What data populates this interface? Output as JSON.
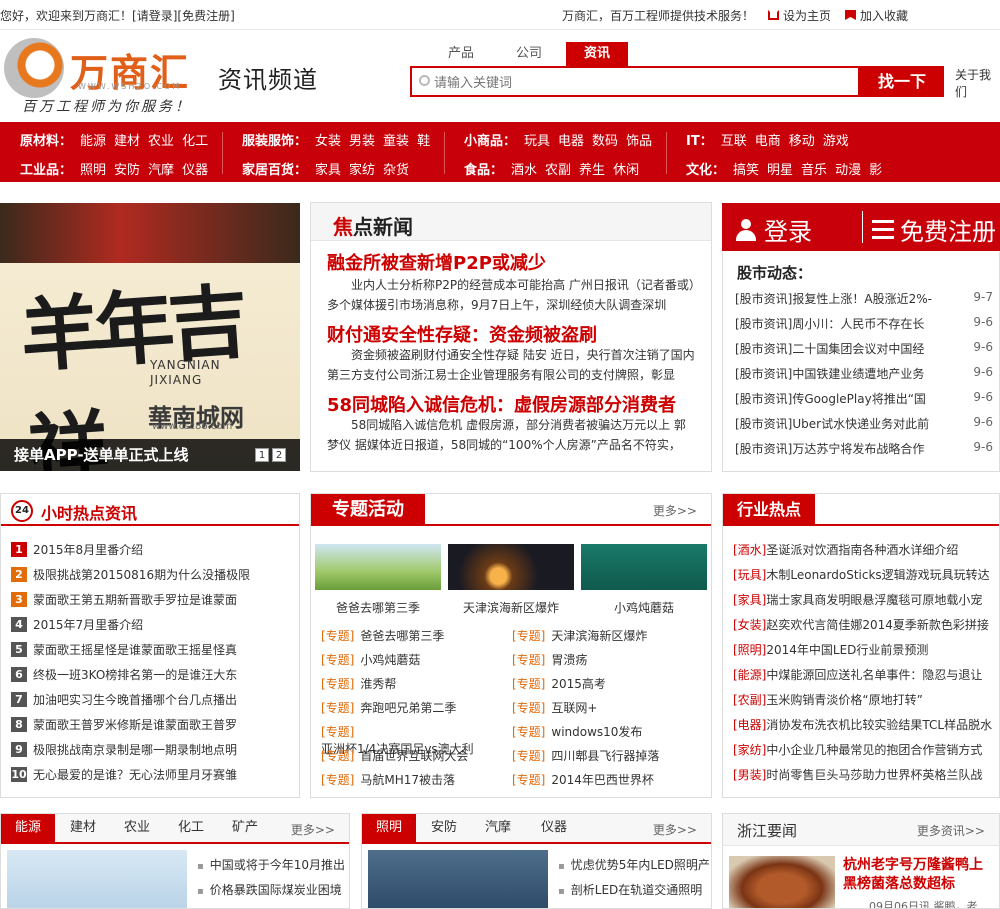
{
  "topbar": {
    "welcome": "您好，欢迎来到万商汇！",
    "login": "[请登录]",
    "register": "[免费注册]",
    "slogan": "万商汇，百万工程师提供技术服务！",
    "set_home": "设为主页",
    "add_fav": "加入收藏"
  },
  "header": {
    "logo_text": "万商汇",
    "logo_url": "WWW.WSHZO.COM",
    "slogan": "百万工程师为你服务！",
    "channel": "资讯频道",
    "search_tabs": [
      "产品",
      "公司",
      "资讯"
    ],
    "search_placeholder": "请输入关键词",
    "search_button": "找一下",
    "about": "关于我们"
  },
  "nav": {
    "row1": [
      {
        "cat": "原材料：",
        "items": [
          "能源",
          "建材",
          "农业",
          "化工"
        ]
      },
      {
        "cat": "服装服饰：",
        "items": [
          "女装",
          "男装",
          "童装",
          "鞋"
        ]
      },
      {
        "cat": "小商品：",
        "items": [
          "玩具",
          "电器",
          "数码",
          "饰品"
        ]
      },
      {
        "cat": "IT：",
        "items": [
          "互联",
          "电商",
          "移动",
          "游戏"
        ]
      }
    ],
    "row2": [
      {
        "cat": "工业品：",
        "items": [
          "照明",
          "安防",
          "汽摩",
          "仪器"
        ]
      },
      {
        "cat": "家居百货：",
        "items": [
          "家具",
          "家纺",
          "杂货"
        ]
      },
      {
        "cat": "食品：",
        "items": [
          "酒水",
          "农副",
          "养生",
          "休闲"
        ]
      },
      {
        "cat": "文化：",
        "items": [
          "搞笑",
          "明星",
          "音乐",
          "动漫",
          "影"
        ]
      }
    ]
  },
  "banner": {
    "caption": "接单APP-送单单正式上线",
    "pages": [
      "1",
      "2"
    ],
    "art_text": "羊年吉祥",
    "art_en": "YANGNIAN\nJIXIANG",
    "art_brand": "華南城网",
    "art_site": "www.csc86.com"
  },
  "focus": {
    "title_red": "焦",
    "title_rest": "点新闻",
    "items": [
      {
        "title": "融金所被查新增P2P或减少",
        "desc": "业内人士分析称P2P的经营成本可能抬高 广州日报讯（记者番或）多个媒体援引市场消息称，9月7日上午，深圳经侦大队调查深圳"
      },
      {
        "title": "财付通安全性存疑：资金频被盗刷",
        "desc": "资金频被盗刷财付通安全性存疑 陆安 近日，央行首次注销了国内第三方支付公司浙江易士企业管理服务有限公司的支付牌照，彰显"
      },
      {
        "title": "58同城陷入诚信危机：虚假房源部分消费者",
        "desc": "58同城陷入诚信危机 虚假房源，部分消费者被骗达万元以上 郭梦仪 据媒体近日报道，58同城的“100%个人房源”产品名不符实，"
      }
    ]
  },
  "login_box": {
    "login": "登录",
    "register": "免费注册"
  },
  "stock": {
    "title": "股市动态：",
    "items": [
      {
        "text": "[股市资讯]报复性上涨！A股涨近2%-",
        "date": "9-7"
      },
      {
        "text": "[股市资讯]周小川：人民币不存在长",
        "date": "9-6"
      },
      {
        "text": "[股市资讯]二十国集团会议对中国经",
        "date": "9-6"
      },
      {
        "text": "[股市资讯]中国铁建业绩遭地产业务",
        "date": "9-6"
      },
      {
        "text": "[股市资讯]传GooglePlay将推出“国",
        "date": "9-6"
      },
      {
        "text": "[股市资讯]Uber试水快递业务对此前",
        "date": "9-6"
      },
      {
        "text": "[股市资讯]万达苏宁将发布战略合作",
        "date": "9-6"
      }
    ]
  },
  "hot24": {
    "badge": "24",
    "title": "小时热点资讯",
    "items": [
      "2015年8月里番介绍",
      "极限挑战第20150816期为什么没播极限",
      "蒙面歌王第五期新晋歌手罗拉是谁蒙面",
      "2015年7月里番介绍",
      "蒙面歌王摇星怪是谁蒙面歌王摇星怪真",
      "终极一班3KO榜排名第一的是谁汪大东",
      "加油吧实习生今晚首播哪个台几点播出",
      "蒙面歌王普罗米修斯是谁蒙面歌王普罗",
      "极限挑战南京录制是哪一期录制地点明",
      "无心最爱的是谁？无心法师里月牙赛雏"
    ]
  },
  "topic": {
    "title": "专题活动",
    "more": "更多>>",
    "thumbs": [
      "爸爸去哪第三季",
      "天津滨海新区爆炸",
      "小鸡炖蘑菇"
    ],
    "tag": "[专题]",
    "left": [
      "爸爸去哪第三季",
      "小鸡炖蘑菇",
      "淮秀帮",
      "奔跑吧兄弟第二季",
      "亚洲杯1/4决赛国足vs澳大利",
      "首届世界互联网大会",
      "马航MH17被击落"
    ],
    "right": [
      "天津滨海新区爆炸",
      "胃溃疡",
      "2015高考",
      "互联网+",
      "windows10发布",
      "四川郫县飞行器掉落",
      "2014年巴西世界杯"
    ]
  },
  "industry": {
    "title": "行业热点",
    "items": [
      {
        "tag": "[酒水]",
        "text": "圣诞派对饮酒指南各种酒水详细介绍"
      },
      {
        "tag": "[玩具]",
        "text": "木制LeonardoSticks逻辑游戏玩具玩转达"
      },
      {
        "tag": "[家具]",
        "text": "瑞士家具商发明眼悬浮魔毯可原地载小宠"
      },
      {
        "tag": "[女装]",
        "text": "赵奕欢代言简佳娜2014夏季新款色彩拼接"
      },
      {
        "tag": "[照明]",
        "text": "2014年中国LED行业前景预测"
      },
      {
        "tag": "[能源]",
        "text": "中煤能源回应送礼名单事件：隐忍与退让"
      },
      {
        "tag": "[农副]",
        "text": "玉米购销青淡价格“原地打转”"
      },
      {
        "tag": "[电器]",
        "text": "消协发布洗衣机比较实验结果TCL样品脱水"
      },
      {
        "tag": "[家纺]",
        "text": "中小企业几种最常见的抱团合作营销方式"
      },
      {
        "tag": "[男装]",
        "text": "时尚零售巨头马莎助力世界杯英格兰队战"
      }
    ]
  },
  "bottom": {
    "sec1": {
      "tabs": [
        "能源",
        "建材",
        "农业",
        "化工",
        "矿产"
      ],
      "more": "更多>>",
      "items": [
        "中国或将于今年10月推出",
        "价格暴跌国际煤炭业困境"
      ]
    },
    "sec2": {
      "tabs": [
        "照明",
        "安防",
        "汽摩",
        "仪器"
      ],
      "more": "更多>>",
      "items": [
        "忧虑优势5年内LED照明产",
        "剖析LED在轨道交通照明"
      ]
    },
    "sec3": {
      "title": "浙江要闻",
      "more": "更多资讯>>",
      "headline": "杭州老字号万隆酱鸭上黑榜菌落总数超标",
      "meta": "09月06日讯  酱鸭，老"
    }
  },
  "colors": {
    "brand_red": "#c8000a",
    "accent_orange": "#e0601a"
  }
}
